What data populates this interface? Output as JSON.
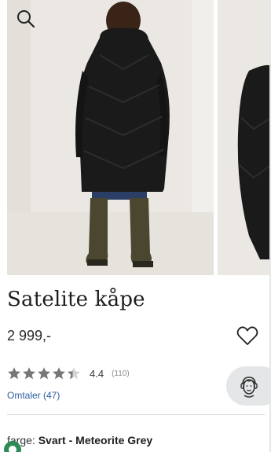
{
  "header": {
    "search_icon": "search-icon"
  },
  "gallery": {
    "images": [
      "main-product-photo",
      "next-product-photo"
    ]
  },
  "product": {
    "title": "Satelite kåpe",
    "price": "2 999,-",
    "favorite_icon": "heart-outline-icon"
  },
  "rating": {
    "stars_filled": 4.4,
    "stars_total": 5,
    "value": "4.4",
    "count": "(110)",
    "star_color": "#777777"
  },
  "reviews": {
    "link_label": "Omtaler (47)"
  },
  "chat": {
    "icon": "customer-service-icon"
  },
  "color": {
    "label": "farge:",
    "value": "Svart - Meteorite Grey"
  },
  "colors": {
    "link": "#2c5f9e",
    "text": "#222222",
    "chat_bg": "#e4e6e8"
  }
}
